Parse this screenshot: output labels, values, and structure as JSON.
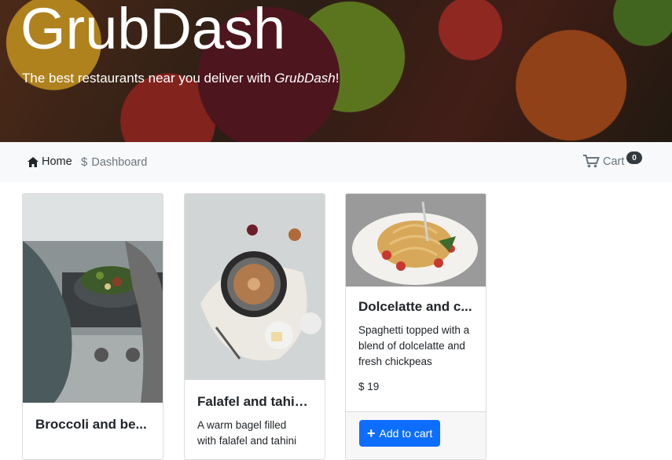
{
  "hero": {
    "title": "GrubDash",
    "tagline_prefix": "The best restaurants near you deliver with ",
    "tagline_brand": "GrubDash",
    "tagline_suffix": "!"
  },
  "nav": {
    "home": "Home",
    "dashboard": "Dashboard",
    "cart": "Cart",
    "cart_count": "0"
  },
  "dishes": [
    {
      "title": "Broccoli and be...",
      "description": "",
      "price": ""
    },
    {
      "title": "Falafel and tahin...",
      "description": "A warm bagel filled with falafel and tahini",
      "price": ""
    },
    {
      "title": "Dolcelatte and c...",
      "description": "Spaghetti topped with a blend of dolcelatte and fresh chickpeas",
      "price": "$ 19",
      "button": "Add to cart"
    }
  ],
  "colors": {
    "primary": "#0d6efd",
    "navbar": "#f8f9fa",
    "badge": "#343a40"
  }
}
